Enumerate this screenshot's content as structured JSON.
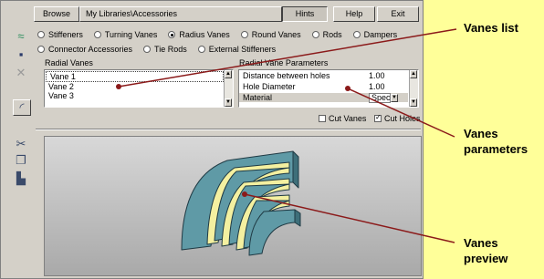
{
  "menubar": {
    "browse": "Browse",
    "path": "My Libraries\\Accessories",
    "hints": "Hints",
    "help": "Help",
    "exit": "Exit"
  },
  "types_row1": [
    "Stiffeners",
    "Turning Vanes",
    "Radius Vanes",
    "Round Vanes",
    "Rods",
    "Dampers"
  ],
  "types_row2": [
    "Connector Accessories",
    "Tie Rods",
    "External Stiffeners"
  ],
  "selected_type": "Radius Vanes",
  "radial_vanes": {
    "label": "Radial Vanes",
    "items": [
      "Vane 1",
      "Vane 2",
      "Vane 3"
    ],
    "selected": "Vane 1"
  },
  "params": {
    "label": "Radial Vane Parameters",
    "rows": [
      {
        "name": "Distance between holes",
        "value": "1.00"
      },
      {
        "name": "Hole Diameter",
        "value": "1.00"
      },
      {
        "name": "Material",
        "value": "Special"
      }
    ]
  },
  "options": {
    "cut_vanes": "Cut Vanes",
    "cut_vanes_checked": false,
    "cut_holes": "Cut Holes",
    "cut_holes_checked": true
  },
  "callouts": {
    "list": "Vanes list",
    "params_1": "Vanes",
    "params_2": "parameters",
    "preview_1": "Vanes",
    "preview_2": "preview"
  },
  "colors": {
    "callout_line": "#8b1a1a",
    "panel_bg": "#d4d0c8",
    "page_bg": "#ffff99",
    "vane_teal": "#5f9aa6",
    "vane_yellow": "#f4f0a0"
  },
  "icons": [
    "wave-tool-icon",
    "save-icon",
    "delete-icon",
    "vane-shape-icon",
    "cut-icon",
    "copy-icon",
    "paste-icon"
  ]
}
